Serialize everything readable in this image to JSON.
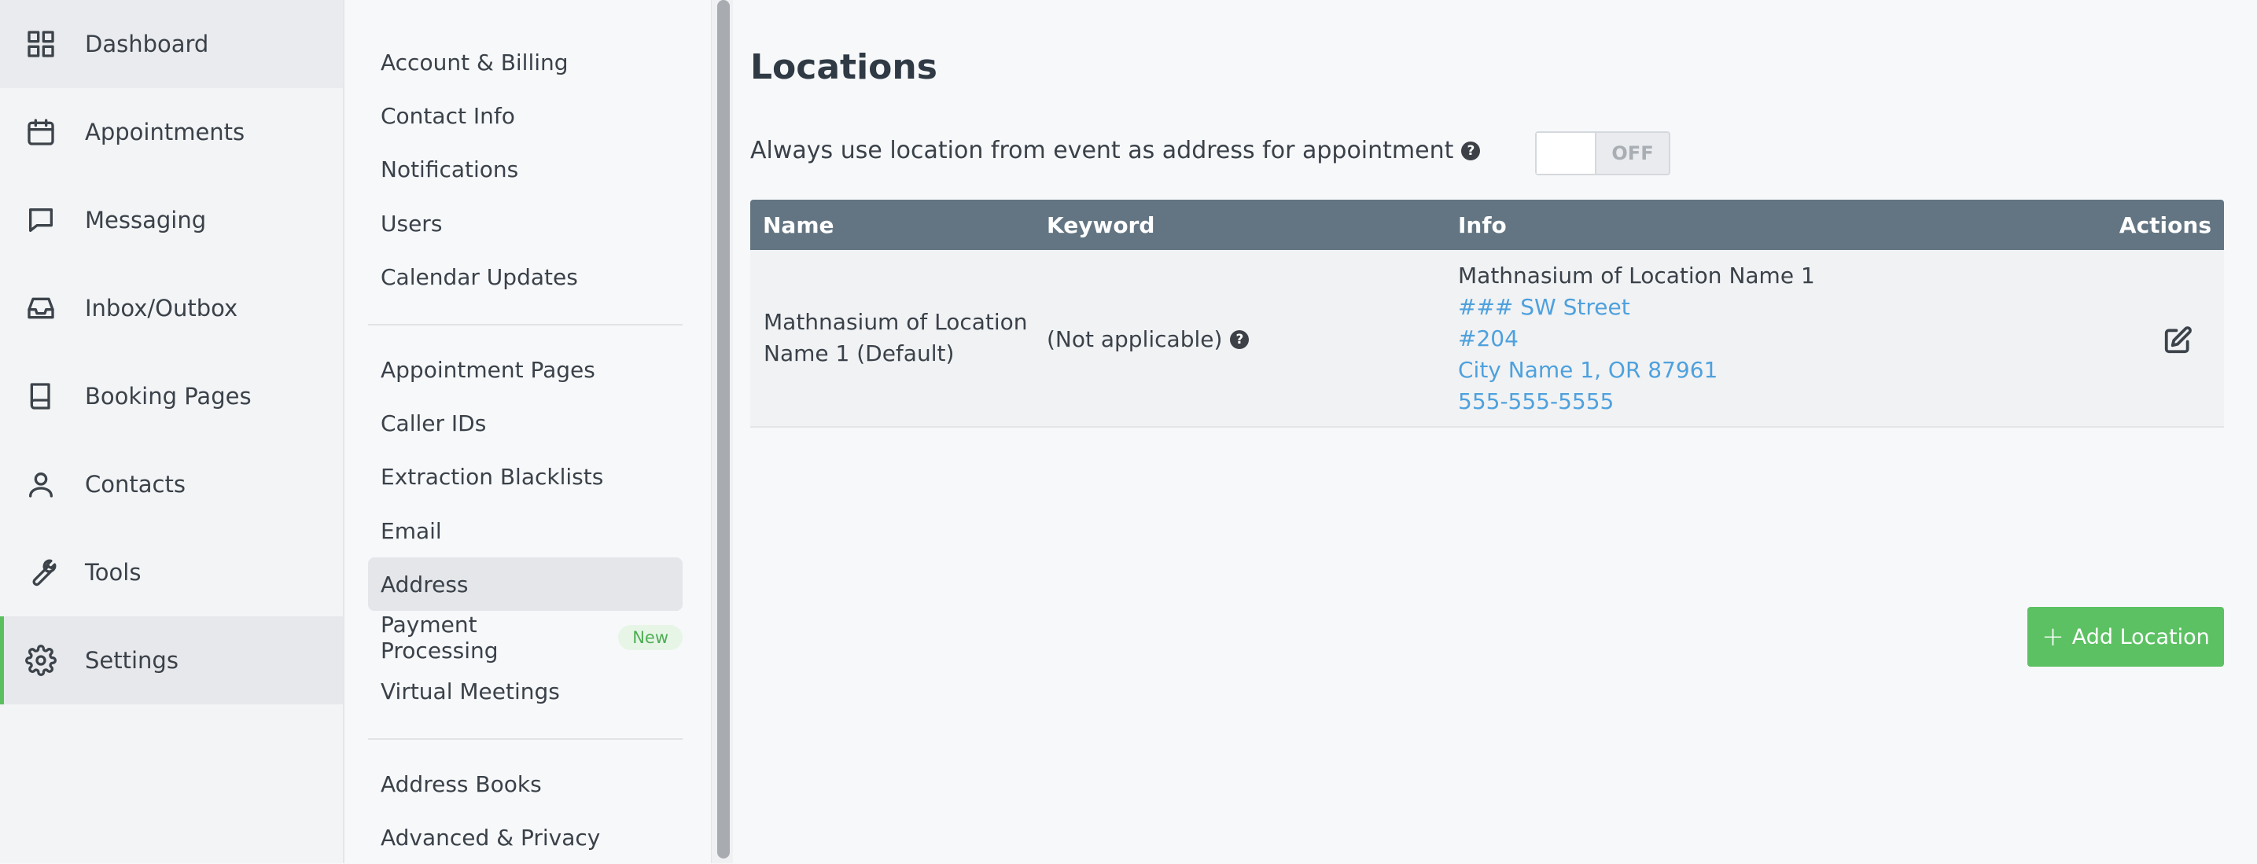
{
  "nav": {
    "items": [
      {
        "label": "Dashboard",
        "icon": "grid-icon"
      },
      {
        "label": "Appointments",
        "icon": "calendar-icon"
      },
      {
        "label": "Messaging",
        "icon": "chat-icon"
      },
      {
        "label": "Inbox/Outbox",
        "icon": "inbox-icon"
      },
      {
        "label": "Booking Pages",
        "icon": "book-icon"
      },
      {
        "label": "Contacts",
        "icon": "person-icon"
      },
      {
        "label": "Tools",
        "icon": "wrench-icon"
      },
      {
        "label": "Settings",
        "icon": "gear-icon"
      }
    ],
    "selected": "Settings"
  },
  "submenu": {
    "group1": [
      "Account & Billing",
      "Contact Info",
      "Notifications",
      "Users",
      "Calendar Updates"
    ],
    "group2": [
      "Appointment Pages",
      "Caller IDs",
      "Extraction Blacklists",
      "Email",
      "Address",
      "Payment Processing",
      "Virtual Meetings"
    ],
    "group3": [
      "Address Books",
      "Advanced & Privacy"
    ],
    "selected": "Address",
    "new_badge": "New"
  },
  "page": {
    "title": "Locations",
    "toggle_label": "Always use location from event as address for appointment",
    "toggle_state": "OFF",
    "help_glyph": "?"
  },
  "table": {
    "columns": [
      "Name",
      "Keyword",
      "Info",
      "Actions"
    ],
    "rows": [
      {
        "name_line1": "Mathnasium of Location",
        "name_line2": "Name 1 (Default)",
        "keyword": "(Not applicable)",
        "info_title": "Mathnasium of Location Name 1",
        "info_street": "### SW Street",
        "info_unit": "#204",
        "info_city": "City Name 1, OR 87961",
        "info_phone": "555-555-5555"
      }
    ]
  },
  "add_button": {
    "plus": "+",
    "label": "Add Location"
  },
  "colors": {
    "accent_green": "#5cc163",
    "header_slate": "#637582",
    "link_blue": "#4ea1dd"
  }
}
